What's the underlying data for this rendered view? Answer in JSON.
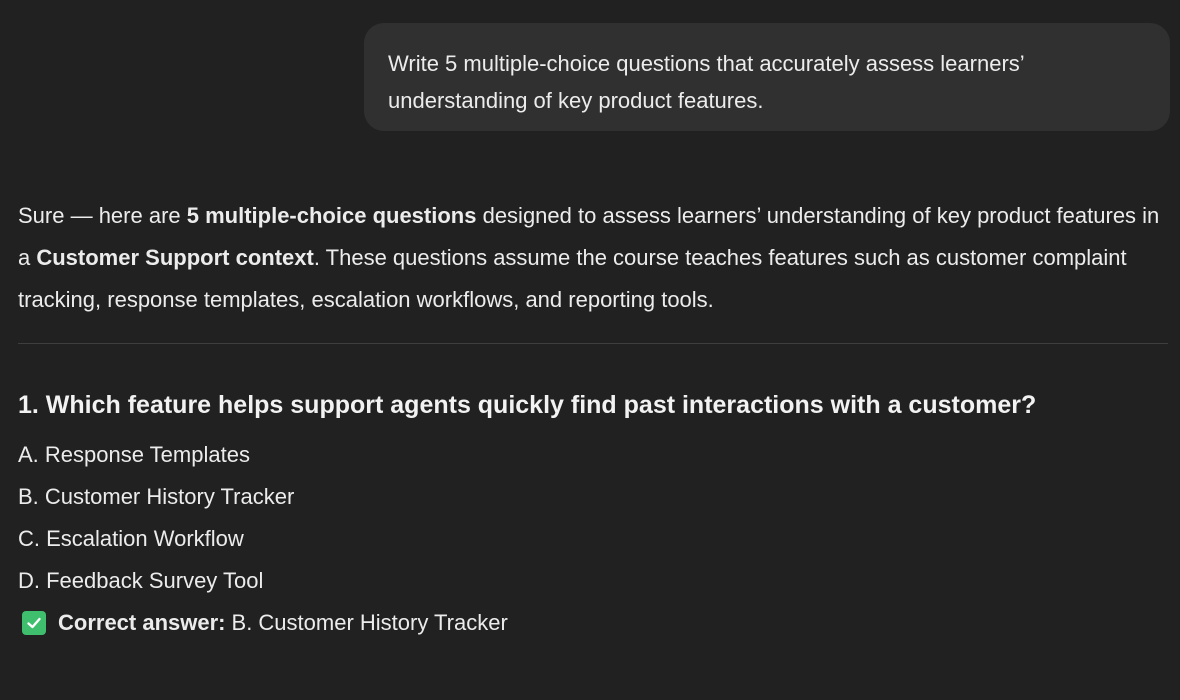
{
  "user_message": {
    "line1": "Write 5 multiple-choice questions that accurately assess learners’",
    "line2": "understanding of key product features."
  },
  "assistant": {
    "intro": {
      "p1": "Sure — here are ",
      "b1": "5 multiple-choice questions",
      "p2": " designed to assess learners’ understanding of key product features in a ",
      "b2": "Customer Support context",
      "p3": ". These questions assume the course teaches features such as customer complaint tracking, response templates, escalation workflows, and reporting tools."
    },
    "question1": {
      "title": "1. Which feature helps support agents quickly find past interactions with a customer?",
      "options": [
        "A. Response Templates",
        "B. Customer History Tracker",
        "C. Escalation Workflow",
        "D. Feedback Survey Tool"
      ],
      "answer_label": "Correct answer:",
      "answer_value": "B. Customer History Tracker",
      "answer_icon": "check-mark-icon",
      "answer_icon_color": "#3fbf6e"
    }
  }
}
